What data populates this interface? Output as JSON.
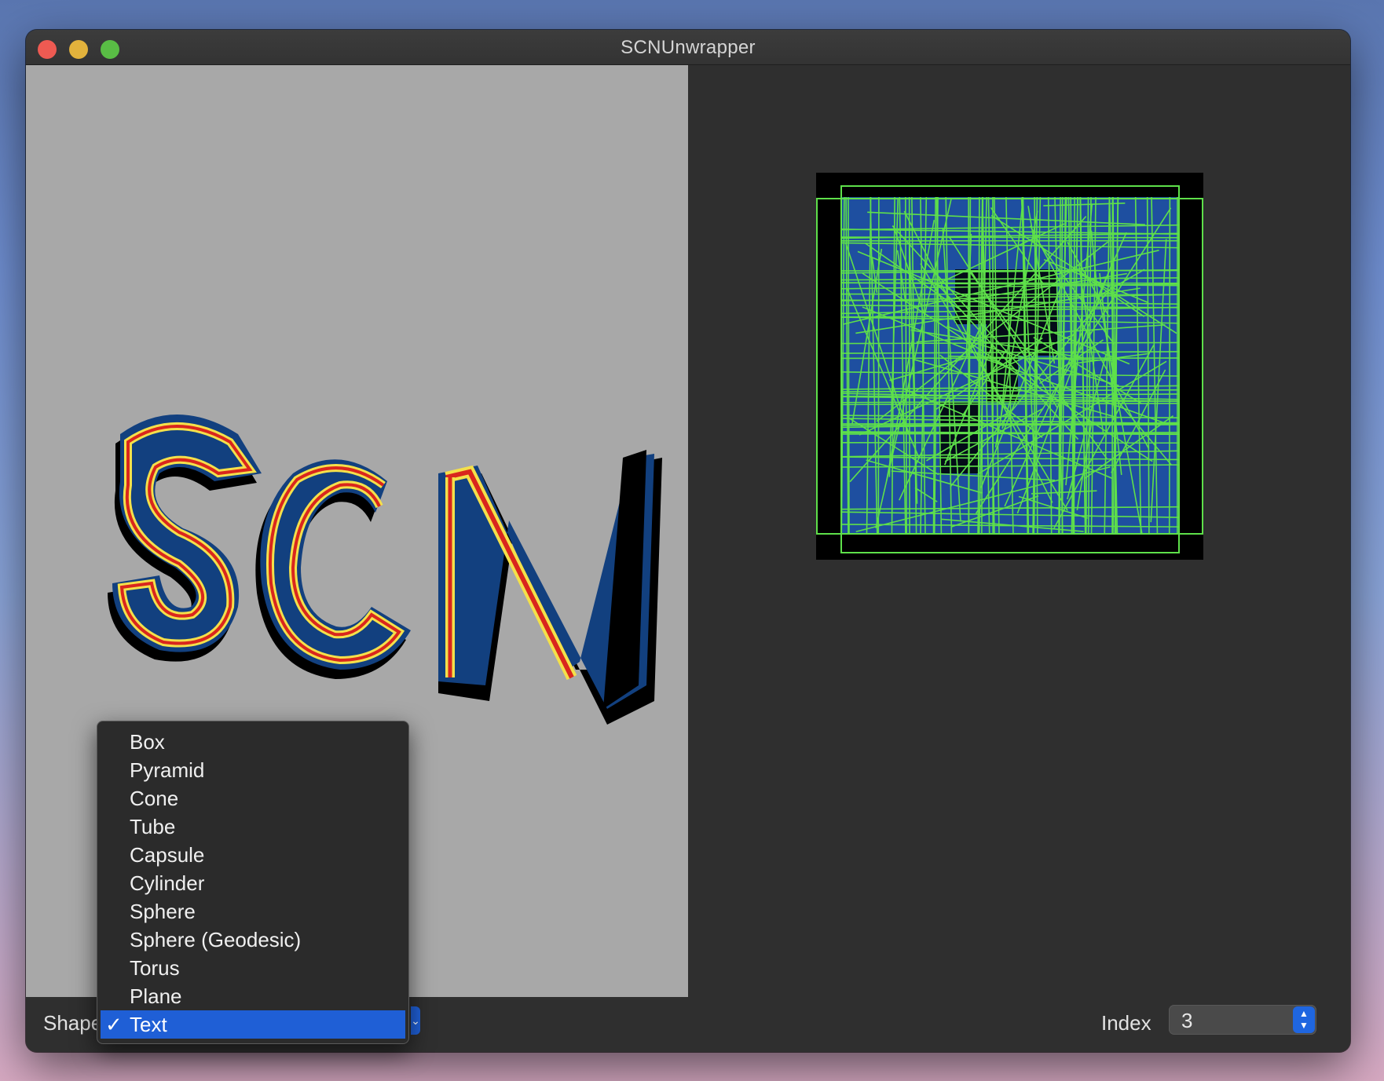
{
  "window": {
    "title": "SCNUnwrapper"
  },
  "scene": {
    "text_rendered": "SCN",
    "background_color": "#a8a8a8"
  },
  "uv_preview": {
    "background_color": "#000000",
    "texture_color": "#1e4fa0",
    "wire_color": "#5ee04a"
  },
  "bottom_bar": {
    "shape_label": "Shape",
    "index_label": "Index",
    "index_value": "3"
  },
  "shape_menu": {
    "items": [
      {
        "label": "Box",
        "selected": false
      },
      {
        "label": "Pyramid",
        "selected": false
      },
      {
        "label": "Cone",
        "selected": false
      },
      {
        "label": "Tube",
        "selected": false
      },
      {
        "label": "Capsule",
        "selected": false
      },
      {
        "label": "Cylinder",
        "selected": false
      },
      {
        "label": "Sphere",
        "selected": false
      },
      {
        "label": "Sphere (Geodesic)",
        "selected": false
      },
      {
        "label": "Torus",
        "selected": false
      },
      {
        "label": "Plane",
        "selected": false
      },
      {
        "label": "Text",
        "selected": true
      }
    ],
    "check_mark": "✓",
    "selected_color": "#1f5fd6"
  }
}
